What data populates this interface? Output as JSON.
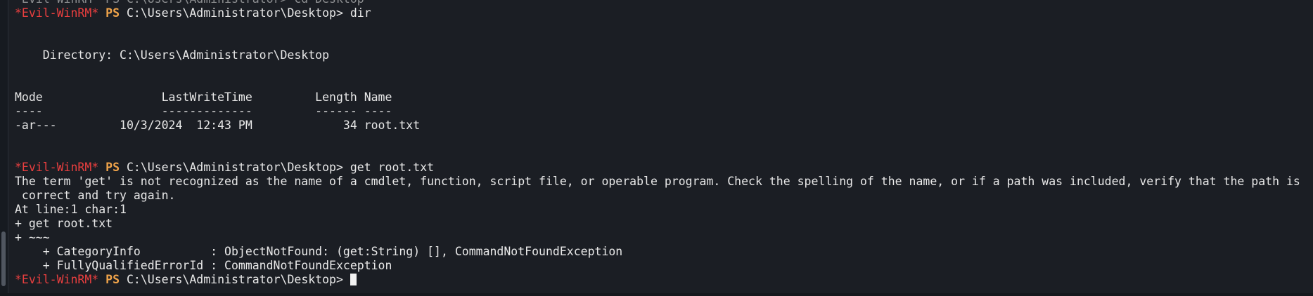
{
  "prompt": {
    "host": "*Evil-WinRM*",
    "ps": "PS",
    "path": "C:\\Users\\Administrator\\Desktop>"
  },
  "terminal": {
    "top_partial_line": "*Evil-WinRM* PS C:\\Users\\Administrator> cd Desktop",
    "cmd1": "dir",
    "directory_line": "    Directory: C:\\Users\\Administrator\\Desktop",
    "table_header": "Mode                 LastWriteTime         Length Name",
    "table_rule": "----                 -------------         ------ ----",
    "table_row": "-ar---         10/3/2024  12:43 PM             34 root.txt",
    "cmd2": "get root.txt",
    "error_line1": "The term 'get' is not recognized as the name of a cmdlet, function, script file, or operable program. Check the spelling of the name, or if a path was included, verify that the path is",
    "error_line2": " correct and try again.",
    "at_line": "At line:1 char:1",
    "plus_cmd": "+ get root.txt",
    "plus_tilde": "+ ~~~",
    "category_info": "    + CategoryInfo          : ObjectNotFound: (get:String) [], CommandNotFoundException",
    "fqid": "    + FullyQualifiedErrorId : CommandNotFoundException"
  }
}
